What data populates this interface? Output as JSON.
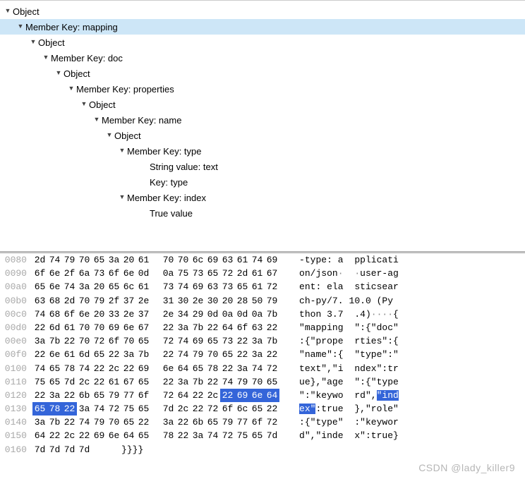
{
  "tree": [
    {
      "indent": 0,
      "arrow": "open",
      "label": "Object",
      "selected": false
    },
    {
      "indent": 18,
      "arrow": "open",
      "label": "Member Key: mapping",
      "selected": true
    },
    {
      "indent": 36,
      "arrow": "open",
      "label": "Object",
      "selected": false
    },
    {
      "indent": 54,
      "arrow": "open",
      "label": "Member Key: doc",
      "selected": false
    },
    {
      "indent": 72,
      "arrow": "open",
      "label": "Object",
      "selected": false
    },
    {
      "indent": 90,
      "arrow": "open",
      "label": "Member Key: properties",
      "selected": false
    },
    {
      "indent": 108,
      "arrow": "open",
      "label": "Object",
      "selected": false
    },
    {
      "indent": 126,
      "arrow": "open",
      "label": "Member Key: name",
      "selected": false
    },
    {
      "indent": 144,
      "arrow": "open",
      "label": "Object",
      "selected": false
    },
    {
      "indent": 162,
      "arrow": "open",
      "label": "Member Key: type",
      "selected": false
    },
    {
      "indent": 194,
      "arrow": "",
      "label": "String value: text",
      "selected": false
    },
    {
      "indent": 194,
      "arrow": "",
      "label": "Key: type",
      "selected": false
    },
    {
      "indent": 162,
      "arrow": "open",
      "label": "Member Key: index",
      "selected": false
    },
    {
      "indent": 194,
      "arrow": "",
      "label": "True value",
      "selected": false
    }
  ],
  "hex": [
    {
      "offset": "0080",
      "b1": [
        "2d",
        "74",
        "79",
        "70",
        "65",
        "3a",
        "20",
        "61"
      ],
      "b2": [
        "70",
        "70",
        "6c",
        "69",
        "63",
        "61",
        "74",
        "69"
      ],
      "a1": "-type: a",
      "a2": " pplicati",
      "hl1": [],
      "hl2": [],
      "ha1": [],
      "ha2": []
    },
    {
      "offset": "0090",
      "b1": [
        "6f",
        "6e",
        "2f",
        "6a",
        "73",
        "6f",
        "6e",
        "0d"
      ],
      "b2": [
        "0a",
        "75",
        "73",
        "65",
        "72",
        "2d",
        "61",
        "67"
      ],
      "a1": "on/json·",
      "a2": " ·user-ag",
      "hl1": [],
      "hl2": [],
      "ha1": [],
      "ha2": []
    },
    {
      "offset": "00a0",
      "b1": [
        "65",
        "6e",
        "74",
        "3a",
        "20",
        "65",
        "6c",
        "61"
      ],
      "b2": [
        "73",
        "74",
        "69",
        "63",
        "73",
        "65",
        "61",
        "72"
      ],
      "a1": "ent: ela",
      "a2": " sticsear",
      "hl1": [],
      "hl2": [],
      "ha1": [],
      "ha2": []
    },
    {
      "offset": "00b0",
      "b1": [
        "63",
        "68",
        "2d",
        "70",
        "79",
        "2f",
        "37",
        "2e"
      ],
      "b2": [
        "31",
        "30",
        "2e",
        "30",
        "20",
        "28",
        "50",
        "79"
      ],
      "a1": "ch-py/7.",
      "a2": "10.0 (Py",
      "hl1": [],
      "hl2": [],
      "ha1": [],
      "ha2": []
    },
    {
      "offset": "00c0",
      "b1": [
        "74",
        "68",
        "6f",
        "6e",
        "20",
        "33",
        "2e",
        "37"
      ],
      "b2": [
        "2e",
        "34",
        "29",
        "0d",
        "0a",
        "0d",
        "0a",
        "7b"
      ],
      "a1": "thon 3.7",
      "a2": " .4)····{",
      "hl1": [],
      "hl2": [],
      "ha1": [],
      "ha2": []
    },
    {
      "offset": "00d0",
      "b1": [
        "22",
        "6d",
        "61",
        "70",
        "70",
        "69",
        "6e",
        "67"
      ],
      "b2": [
        "22",
        "3a",
        "7b",
        "22",
        "64",
        "6f",
        "63",
        "22"
      ],
      "a1": "\"mapping",
      "a2": " \":{\"doc\"",
      "hl1": [],
      "hl2": [],
      "ha1": [],
      "ha2": []
    },
    {
      "offset": "00e0",
      "b1": [
        "3a",
        "7b",
        "22",
        "70",
        "72",
        "6f",
        "70",
        "65"
      ],
      "b2": [
        "72",
        "74",
        "69",
        "65",
        "73",
        "22",
        "3a",
        "7b"
      ],
      "a1": ":{\"prope",
      "a2": " rties\":{",
      "hl1": [],
      "hl2": [],
      "ha1": [],
      "ha2": []
    },
    {
      "offset": "00f0",
      "b1": [
        "22",
        "6e",
        "61",
        "6d",
        "65",
        "22",
        "3a",
        "7b"
      ],
      "b2": [
        "22",
        "74",
        "79",
        "70",
        "65",
        "22",
        "3a",
        "22"
      ],
      "a1": "\"name\":{",
      "a2": " \"type\":\"",
      "hl1": [],
      "hl2": [],
      "ha1": [],
      "ha2": []
    },
    {
      "offset": "0100",
      "b1": [
        "74",
        "65",
        "78",
        "74",
        "22",
        "2c",
        "22",
        "69"
      ],
      "b2": [
        "6e",
        "64",
        "65",
        "78",
        "22",
        "3a",
        "74",
        "72"
      ],
      "a1": "text\",\"i",
      "a2": " ndex\":tr",
      "hl1": [],
      "hl2": [],
      "ha1": [],
      "ha2": []
    },
    {
      "offset": "0110",
      "b1": [
        "75",
        "65",
        "7d",
        "2c",
        "22",
        "61",
        "67",
        "65"
      ],
      "b2": [
        "22",
        "3a",
        "7b",
        "22",
        "74",
        "79",
        "70",
        "65"
      ],
      "a1": "ue},\"age",
      "a2": " \":{\"type",
      "hl1": [],
      "hl2": [],
      "ha1": [],
      "ha2": []
    },
    {
      "offset": "0120",
      "b1": [
        "22",
        "3a",
        "22",
        "6b",
        "65",
        "79",
        "77",
        "6f"
      ],
      "b2": [
        "72",
        "64",
        "22",
        "2c",
        "22",
        "69",
        "6e",
        "64"
      ],
      "a1": "\":\"keywo",
      "a2": " rd\",\"ind",
      "hl1": [],
      "hl2": [
        4,
        5,
        6,
        7
      ],
      "ha1": [],
      "ha2": [
        5,
        6,
        7,
        8
      ]
    },
    {
      "offset": "0130",
      "b1": [
        "65",
        "78",
        "22",
        "3a",
        "74",
        "72",
        "75",
        "65"
      ],
      "b2": [
        "7d",
        "2c",
        "22",
        "72",
        "6f",
        "6c",
        "65",
        "22"
      ],
      "a1": "ex\":true",
      "a2": " },\"role\"",
      "hl1": [
        0,
        1,
        2
      ],
      "hl2": [],
      "ha1": [
        0,
        1,
        2
      ],
      "ha2": []
    },
    {
      "offset": "0140",
      "b1": [
        "3a",
        "7b",
        "22",
        "74",
        "79",
        "70",
        "65",
        "22"
      ],
      "b2": [
        "3a",
        "22",
        "6b",
        "65",
        "79",
        "77",
        "6f",
        "72"
      ],
      "a1": ":{\"type\"",
      "a2": " :\"keywor",
      "hl1": [],
      "hl2": [],
      "ha1": [],
      "ha2": []
    },
    {
      "offset": "0150",
      "b1": [
        "64",
        "22",
        "2c",
        "22",
        "69",
        "6e",
        "64",
        "65"
      ],
      "b2": [
        "78",
        "22",
        "3a",
        "74",
        "72",
        "75",
        "65",
        "7d"
      ],
      "a1": "d\",\"inde",
      "a2": " x\":true}",
      "hl1": [],
      "hl2": [],
      "ha1": [],
      "ha2": []
    },
    {
      "offset": "0160",
      "b1": [
        "7d",
        "7d",
        "7d",
        "7d"
      ],
      "b2": [],
      "a1": "}}}}",
      "a2": "",
      "hl1": [],
      "hl2": [],
      "ha1": [],
      "ha2": []
    }
  ],
  "watermark": "CSDN @lady_killer9"
}
